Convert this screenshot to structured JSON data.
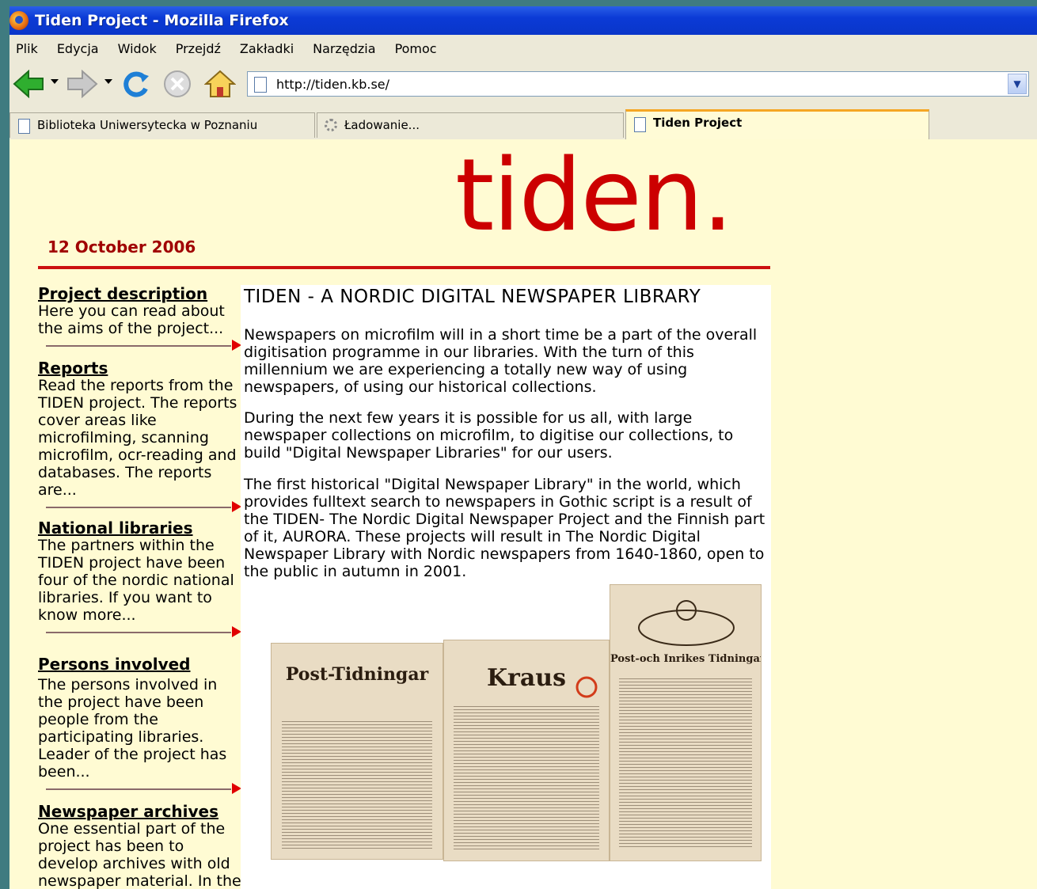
{
  "window": {
    "title": "Tiden Project - Mozilla Firefox"
  },
  "menu": [
    "Plik",
    "Edycja",
    "Widok",
    "Przejdź",
    "Zakładki",
    "Narzędzia",
    "Pomoc"
  ],
  "url": "http://tiden.kb.se/",
  "tabs": [
    {
      "label": "Biblioteka Uniwersytecka w Poznaniu",
      "icon": "page-icon"
    },
    {
      "label": "Ładowanie...",
      "icon": "loading-icon"
    },
    {
      "label": "Tiden Project",
      "icon": "page-icon",
      "active": true
    }
  ],
  "site": {
    "logo": "tiden.",
    "date": "12 October 2006",
    "accent": "#cc0000"
  },
  "sidebar": [
    {
      "title": "Project description",
      "text": "Here you can read about the aims of the project..."
    },
    {
      "title": "Reports",
      "text": "Read the reports from the TIDEN project. The reports cover areas like microfilming, scanning microfilm, ocr-reading and databases. The reports are..."
    },
    {
      "title": "National libraries",
      "text": "The partners within the TIDEN project have been four of the nordic national libraries. If you want to know more..."
    },
    {
      "title": "Persons involved",
      "text": "The persons involved in the project have been people from the participating libraries. Leader of the project has been..."
    },
    {
      "title": "Newspaper archives",
      "text": "One essential part of the project has been to develop archives with old newspaper material. In the archives you can..."
    }
  ],
  "main": {
    "heading": "TIDEN - A NORDIC DIGITAL NEWSPAPER LIBRARY",
    "paragraphs": [
      "Newspapers on microfilm will in a short time be a part of the overall digitisation programme in our libraries. With the turn of this millennium we are experiencing a totally new way of using newspapers, of using our historical collections.",
      "During the next few years it is possible for us all, with large newspaper collections on microfilm, to digitise our collections, to build \"Digital Newspaper Libraries\" for our users.",
      "The first historical \"Digital Newspaper Library\" in the world, which provides fulltext search to newspapers in Gothic script is a result of the TIDEN- The Nordic Digital Newspaper Project and the Finnish part of it, AURORA. These projects will result in The Nordic Digital Newspaper Library with Nordic newspapers from 1640-1860, open to the public in autumn in 2001."
    ],
    "newspapers": [
      "Post-Tidningar",
      "Kraus",
      "Post-och Inrikes Tidningar"
    ]
  }
}
